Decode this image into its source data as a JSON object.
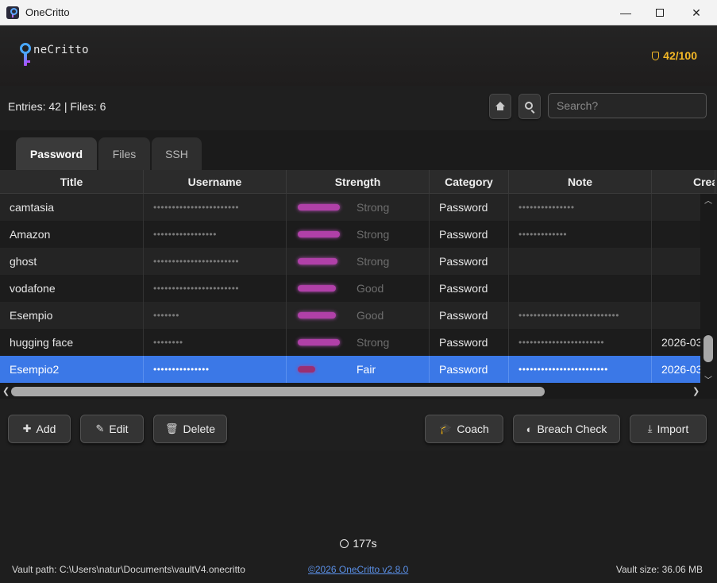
{
  "window": {
    "title": "OneCritto",
    "min_label": "—",
    "close_label": "✕"
  },
  "header": {
    "wordmark": "neCritto",
    "score": "42/100"
  },
  "toolbar": {
    "entries_text": "Entries: 42 | Files: 6",
    "search_placeholder": "Search?"
  },
  "tabs": [
    {
      "label": "Password"
    },
    {
      "label": "Files"
    },
    {
      "label": "SSH"
    }
  ],
  "table": {
    "columns": [
      "Title",
      "Username",
      "Strength",
      "Category",
      "Note",
      "Crea"
    ],
    "rows": [
      {
        "title": "camtasia",
        "username": "•••••••••••••••••••••••",
        "strength": "Strong",
        "strength_level": 0.95,
        "category": "Password",
        "note": "•••••••••••••••",
        "created": ""
      },
      {
        "title": "Amazon",
        "username": "•••••••••••••••••",
        "strength": "Strong",
        "strength_level": 0.95,
        "category": "Password",
        "note": "•••••••••••••",
        "created": ""
      },
      {
        "title": "ghost",
        "username": "•••••••••••••••••••••••",
        "strength": "Strong",
        "strength_level": 0.9,
        "category": "Password",
        "note": "",
        "created": ""
      },
      {
        "title": "vodafone",
        "username": "•••••••••••••••••••••••",
        "strength": "Good",
        "strength_level": 0.85,
        "category": "Password",
        "note": "",
        "created": ""
      },
      {
        "title": "Esempio",
        "username": "•••••••",
        "strength": "Good",
        "strength_level": 0.85,
        "category": "Password",
        "note": "•••••••••••••••••••••••••••",
        "created": ""
      },
      {
        "title": "hugging face",
        "username": "••••••••",
        "strength": "Strong",
        "strength_level": 0.95,
        "category": "Password",
        "note": "•••••••••••••••••••••••",
        "created": "2026-03-"
      },
      {
        "title": "Esempio2",
        "username": "•••••••••••••••",
        "strength": "Fair",
        "strength_level": 0.4,
        "category": "Password",
        "note": "••••••••••••••••••••••••",
        "created": "2026-03-"
      }
    ]
  },
  "actions": {
    "add": "Add",
    "edit": "Edit",
    "delete": "Delete",
    "coach": "Coach",
    "breach": "Breach Check",
    "import": "Import"
  },
  "footer": {
    "timer": "177s",
    "vault_path": "Vault path: C:\\Users\\natur\\Documents\\vaultV4.onecritto",
    "copyright": "©2026 OneCritto v2.8.0",
    "vault_size": "Vault size: 36.06 MB"
  },
  "colors": {
    "accent": "#3b78e7",
    "score": "#f4b826",
    "strength_bar": "#b040a8"
  }
}
